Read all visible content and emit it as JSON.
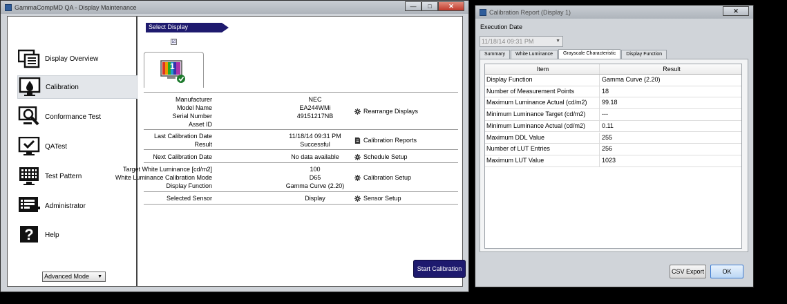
{
  "main_window": {
    "title": "GammaCompMD QA - Display Maintenance",
    "sidebar": {
      "items": [
        {
          "label": "Display Overview",
          "icon": "monitor-list-icon"
        },
        {
          "label": "Calibration",
          "icon": "calibration-icon",
          "selected": true
        },
        {
          "label": "Conformance Test",
          "icon": "magnifier-monitor-icon"
        },
        {
          "label": "QATest",
          "icon": "checkmark-monitor-icon"
        },
        {
          "label": "Test Pattern",
          "icon": "test-pattern-icon"
        },
        {
          "label": "Administrator",
          "icon": "admin-list-icon"
        },
        {
          "label": "Help",
          "icon": "question-icon"
        }
      ],
      "mode_select": "Advanced Mode"
    },
    "select_display_label": "Select Display",
    "display_checkbox": "☑",
    "display_badge": "1",
    "info": {
      "manufacturer_label": "Manufacturer",
      "manufacturer": "NEC",
      "model_label": "Model Name",
      "model": "EA244WMi",
      "serial_label": "Serial Number",
      "serial": "49151217NB",
      "asset_label": "Asset ID",
      "asset": "",
      "last_cal_label": "Last Calibration Date",
      "last_cal": "11/18/14 09:31 PM",
      "result_label": "Result",
      "result": "Successful",
      "next_cal_label": "Next Calibration Date",
      "next_cal": "No data available",
      "target_white_label": "Target White Luminance [cd/m2]",
      "target_white": "100",
      "white_mode_label": "White Luminance Calibration Mode",
      "white_mode": "D65",
      "display_function_label": "Display Function",
      "display_function": "Gamma Curve (2.20)",
      "sensor_label": "Selected Sensor",
      "sensor": "Display"
    },
    "links": {
      "rearrange": "Rearrange Displays",
      "reports": "Calibration Reports",
      "schedule": "Schedule Setup",
      "calibration_setup": "Calibration Setup",
      "sensor_setup": "Sensor Setup"
    },
    "start_button": "Start Calibration"
  },
  "report_window": {
    "title": "Calibration Report (Display 1)",
    "execution_date_label": "Execution Date",
    "execution_date": "11/18/14 09:31 PM",
    "tabs": [
      "Summary",
      "White Luminance",
      "Grayscale Characteristic",
      "Display Function"
    ],
    "active_tab": 2,
    "table": {
      "headers": [
        "Item",
        "Result"
      ],
      "rows": [
        [
          "Display Function",
          "Gamma Curve (2.20)"
        ],
        [
          "Number of Measurement Points",
          "18"
        ],
        [
          "Maximum Luminance Actual (cd/m2)",
          "99.18"
        ],
        [
          "Minimum Luminance Target (cd/m2)",
          "---"
        ],
        [
          "Minimum Luminance Actual  (cd/m2)",
          "0.11"
        ],
        [
          "Maximum DDL Value",
          "255"
        ],
        [
          "Number of LUT Entries",
          "256"
        ],
        [
          "Maximum LUT Value",
          "1023"
        ]
      ]
    },
    "csv_button": "CSV Export",
    "ok_button": "OK"
  }
}
